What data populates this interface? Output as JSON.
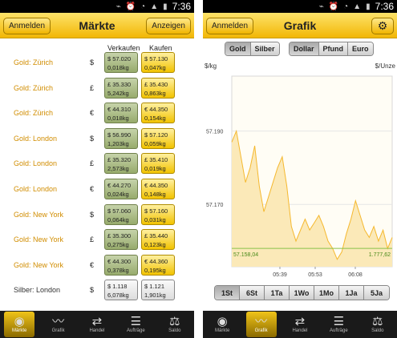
{
  "status": {
    "time": "7:36"
  },
  "markets": {
    "header": {
      "title": "Märkte",
      "left_button": "Anmelden",
      "right_button": "Anzeigen"
    },
    "columns": {
      "sell": "Verkaufen",
      "buy": "Kaufen"
    },
    "rows": [
      {
        "name": "Gold: Zürich",
        "currency": "$",
        "sell_price": "$ 57.020",
        "sell_change": "0,018kg",
        "buy_price": "$ 57.130",
        "buy_change": "0,047kg"
      },
      {
        "name": "Gold: Zürich",
        "currency": "£",
        "sell_price": "£ 35.330",
        "sell_change": "5,242kg",
        "buy_price": "£ 35.430",
        "buy_change": "0,863kg"
      },
      {
        "name": "Gold: Zürich",
        "currency": "€",
        "sell_price": "€ 44.310",
        "sell_change": "0,018kg",
        "buy_price": "€ 44.350",
        "buy_change": "0,154kg"
      },
      {
        "name": "Gold: London",
        "currency": "$",
        "sell_price": "$ 56.990",
        "sell_change": "1,203kg",
        "buy_price": "$ 57.120",
        "buy_change": "0,059kg"
      },
      {
        "name": "Gold: London",
        "currency": "£",
        "sell_price": "£ 35.320",
        "sell_change": "2,573kg",
        "buy_price": "£ 35.410",
        "buy_change": "0,019kg"
      },
      {
        "name": "Gold: London",
        "currency": "€",
        "sell_price": "€ 44.270",
        "sell_change": "0,024kg",
        "buy_price": "€ 44.350",
        "buy_change": "0,148kg"
      },
      {
        "name": "Gold: New York",
        "currency": "$",
        "sell_price": "$ 57.060",
        "sell_change": "0,064kg",
        "buy_price": "$ 57.160",
        "buy_change": "0,031kg"
      },
      {
        "name": "Gold: New York",
        "currency": "£",
        "sell_price": "£ 35.300",
        "sell_change": "0,275kg",
        "buy_price": "£ 35.440",
        "buy_change": "0,123kg"
      },
      {
        "name": "Gold: New York",
        "currency": "€",
        "sell_price": "€ 44.300",
        "sell_change": "0,378kg",
        "buy_price": "€ 44.360",
        "buy_change": "0,195kg"
      },
      {
        "name": "Silber: London",
        "currency": "$",
        "sell_price": "$ 1.118",
        "sell_change": "6,078kg",
        "buy_price": "$ 1.121",
        "buy_change": "1,901kg"
      }
    ],
    "nav": [
      {
        "label": "Märkte",
        "icon": "globe-icon"
      },
      {
        "label": "Grafik",
        "icon": "chart-icon"
      },
      {
        "label": "Handel",
        "icon": "trade-arrows-icon"
      },
      {
        "label": "Aufträge",
        "icon": "orders-icon"
      },
      {
        "label": "Saldo",
        "icon": "scale-icon"
      }
    ]
  },
  "grafik": {
    "header": {
      "title": "Grafik",
      "left_button": "Anmelden",
      "settings_icon": "gear-icon"
    },
    "metal_options": [
      "Gold",
      "Silber"
    ],
    "selected_metal": "Gold",
    "currency_options": [
      "Dollar",
      "Pfund",
      "Euro"
    ],
    "selected_currency": "Dollar",
    "time_ranges": [
      "1St",
      "6St",
      "1Ta",
      "1Wo",
      "1Mo",
      "1Ja",
      "5Ja"
    ],
    "selected_range": "1St",
    "nav": [
      {
        "label": "Märkte",
        "icon": "globe-icon"
      },
      {
        "label": "Grafik",
        "icon": "chart-icon"
      },
      {
        "label": "Handel",
        "icon": "trade-arrows-icon"
      },
      {
        "label": "Aufträge",
        "icon": "orders-icon"
      },
      {
        "label": "Saldo",
        "icon": "scale-icon"
      }
    ],
    "colors": {
      "line": "#f5b82e",
      "fill": "#fbe9b8",
      "reference": "#8ac24a",
      "reference_label": "#4a8a1a"
    },
    "chart_data": {
      "type": "area",
      "ylabel_left": "$/kg",
      "ylabel_right": "$/Unze",
      "yticks": [
        57.19,
        57.17
      ],
      "ytick_labels": [
        "57.190",
        "57.170"
      ],
      "xtick_labels": [
        "05:39",
        "05:53",
        "06:08"
      ],
      "reference_left_label": "57.158,04",
      "reference_right_label": "1.777,62",
      "reference_value": 57.158,
      "ylim": [
        57.153,
        57.205
      ],
      "values": [
        57.187,
        57.19,
        57.183,
        57.176,
        57.18,
        57.186,
        57.175,
        57.168,
        57.172,
        57.176,
        57.18,
        57.183,
        57.175,
        57.164,
        57.16,
        57.163,
        57.166,
        57.163,
        57.165,
        57.167,
        57.164,
        57.16,
        57.158,
        57.155,
        57.157,
        57.162,
        57.166,
        57.171,
        57.167,
        57.163,
        57.161,
        57.164,
        57.16,
        57.163,
        57.158,
        57.161
      ]
    }
  }
}
